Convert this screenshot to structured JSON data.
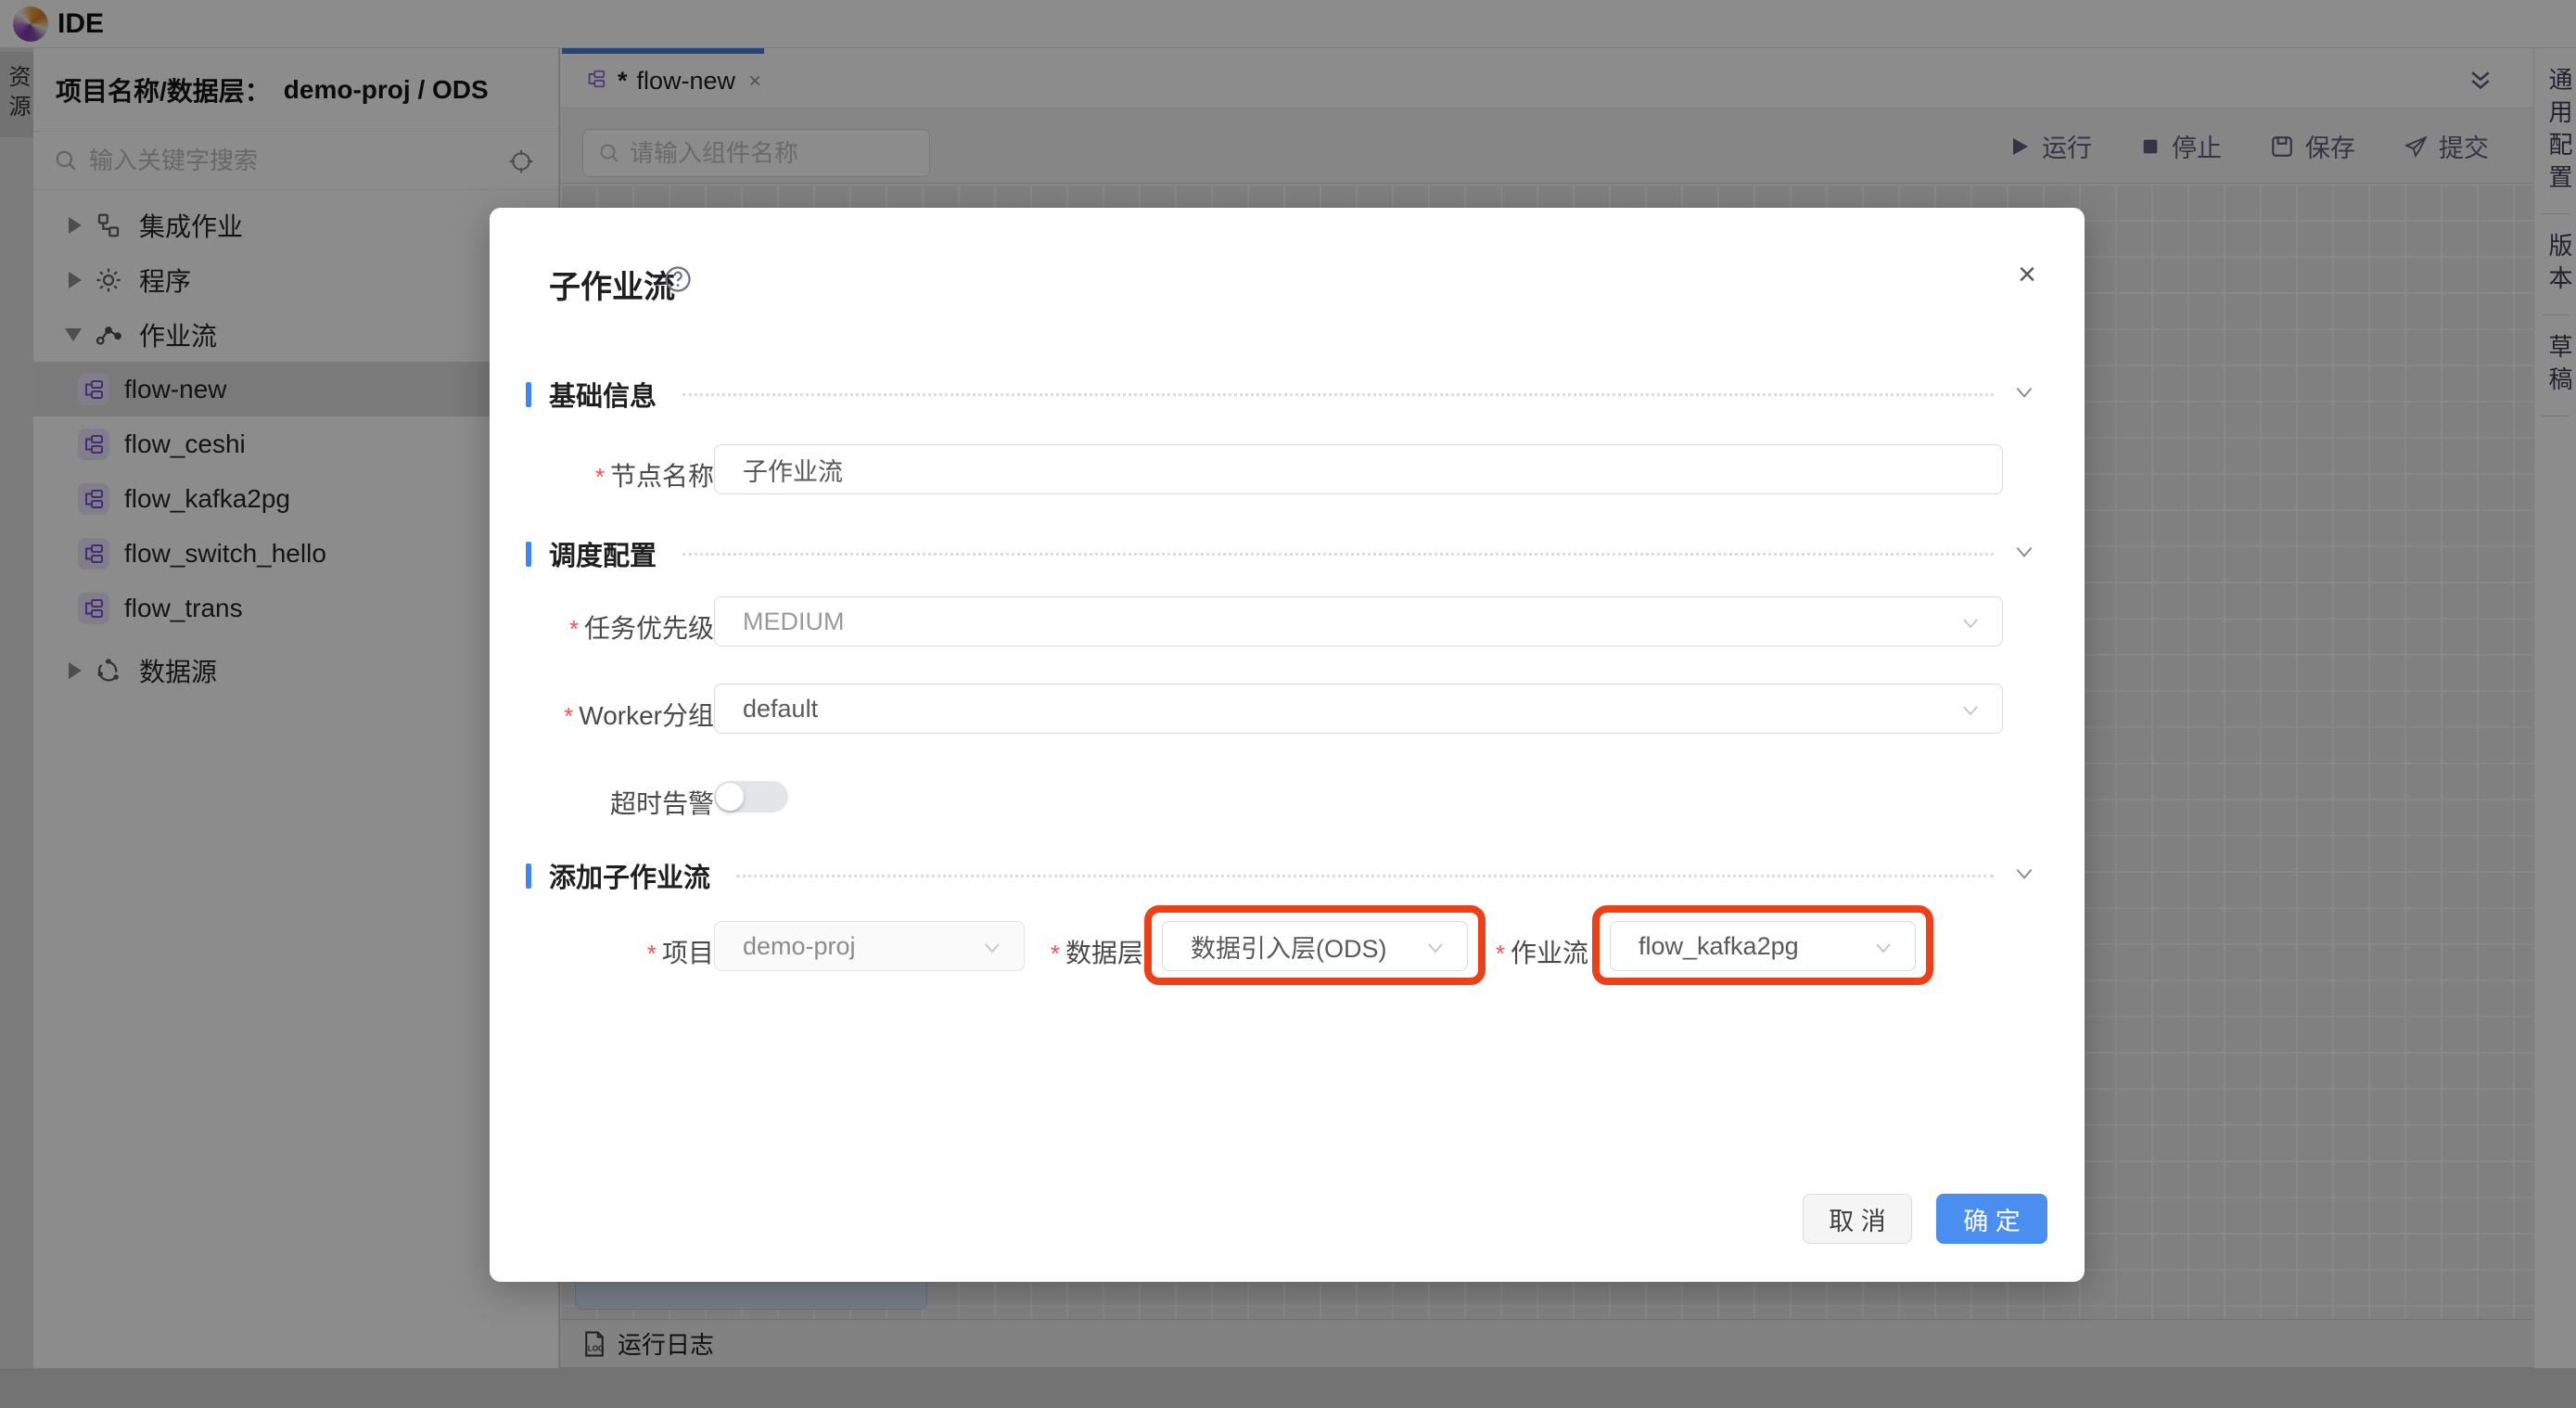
{
  "app": {
    "title": "IDE"
  },
  "left_rail": {
    "active_tab": "资源"
  },
  "sidebar": {
    "header_label": "项目名称/数据层：",
    "header_value": "demo-proj / ODS",
    "search_placeholder": "输入关键字搜索",
    "tree": [
      {
        "label": "集成作业"
      },
      {
        "label": "程序"
      },
      {
        "label": "作业流"
      },
      {
        "label": "flow-new"
      },
      {
        "label": "flow_ceshi"
      },
      {
        "label": "flow_kafka2pg"
      },
      {
        "label": "flow_switch_hello"
      },
      {
        "label": "flow_trans"
      },
      {
        "label": "数据源"
      }
    ]
  },
  "editor": {
    "tab": {
      "dirty_marker": "*",
      "title": "flow-new",
      "close": "×"
    },
    "component_search_placeholder": "请输入组件名称",
    "toolbar": [
      {
        "label": "运行"
      },
      {
        "label": "停止"
      },
      {
        "label": "保存"
      },
      {
        "label": "提交"
      }
    ],
    "log_bar_label": "运行日志"
  },
  "right_rail": {
    "items": [
      "通用配置",
      "版本",
      "草稿"
    ]
  },
  "modal": {
    "title": "子作业流",
    "close": "×",
    "required_marker": "*",
    "sections": [
      {
        "title": "基础信息"
      },
      {
        "title": "调度配置"
      },
      {
        "title": "添加子作业流"
      }
    ],
    "fields": {
      "node_name": {
        "label": "节点名称",
        "value": "子作业流"
      },
      "priority": {
        "label": "任务优先级",
        "value": "MEDIUM"
      },
      "worker_group": {
        "label": "Worker分组",
        "value": "default"
      },
      "timeout": {
        "label": "超时告警"
      },
      "project": {
        "label": "项目",
        "value": "demo-proj"
      },
      "data_layer": {
        "label": "数据层",
        "value": "数据引入层(ODS)"
      },
      "workflow": {
        "label": "作业流",
        "value": "flow_kafka2pg"
      }
    },
    "buttons": {
      "cancel": "取 消",
      "ok": "确 定"
    }
  },
  "colors": {
    "accent_blue": "#4a8ef0",
    "section_blue": "#3d87f5",
    "tab_indicator_blue": "#4a7fd6",
    "highlight_red": "#ee4018",
    "flow_icon_purple": "#7a52d6"
  }
}
